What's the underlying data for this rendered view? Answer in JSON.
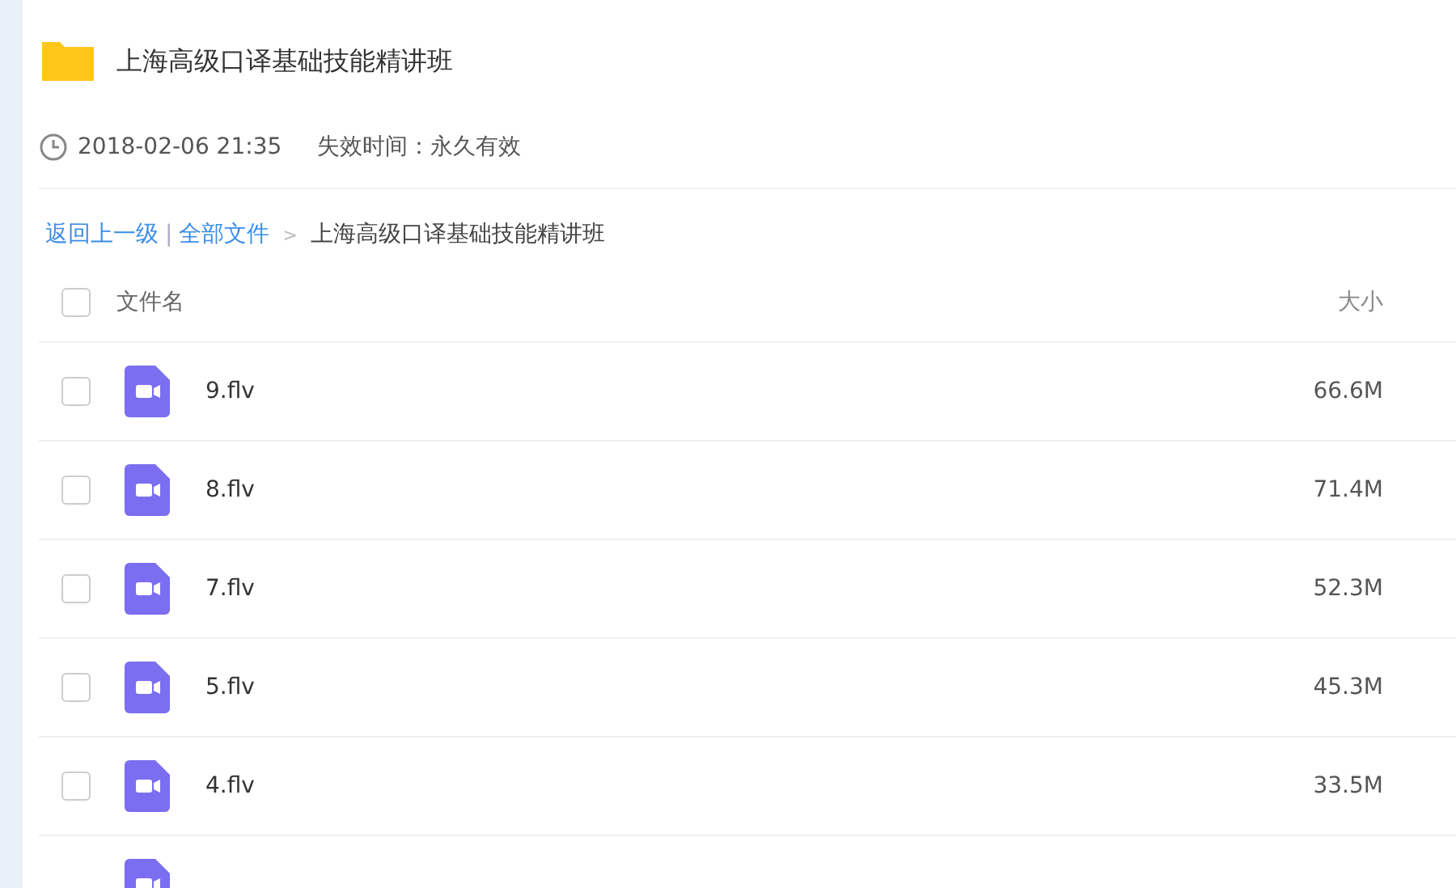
{
  "folder": {
    "title": "上海高级口译基础技能精讲班",
    "kind": "folder"
  },
  "meta": {
    "created": "2018-02-06 21:35",
    "expiry": "失效时间：永久有效"
  },
  "breadcrumb": {
    "back": "返回上一级",
    "separator": "|",
    "root": "全部文件",
    "arrow": ">",
    "current": "上海高级口译基础技能精讲班"
  },
  "table": {
    "columns": [
      "文件名",
      "大小"
    ],
    "all_checked": false,
    "rows": [
      {
        "kind": "video",
        "name": "9.flv",
        "size": "66.6M",
        "checked": false
      },
      {
        "kind": "video",
        "name": "8.flv",
        "size": "71.4M",
        "checked": false
      },
      {
        "kind": "video",
        "name": "7.flv",
        "size": "52.3M",
        "checked": false
      },
      {
        "kind": "video",
        "name": "5.flv",
        "size": "45.3M",
        "checked": false
      },
      {
        "kind": "video",
        "name": "4.flv",
        "size": "33.5M",
        "checked": false
      },
      {
        "kind": "video"
      }
    ]
  }
}
